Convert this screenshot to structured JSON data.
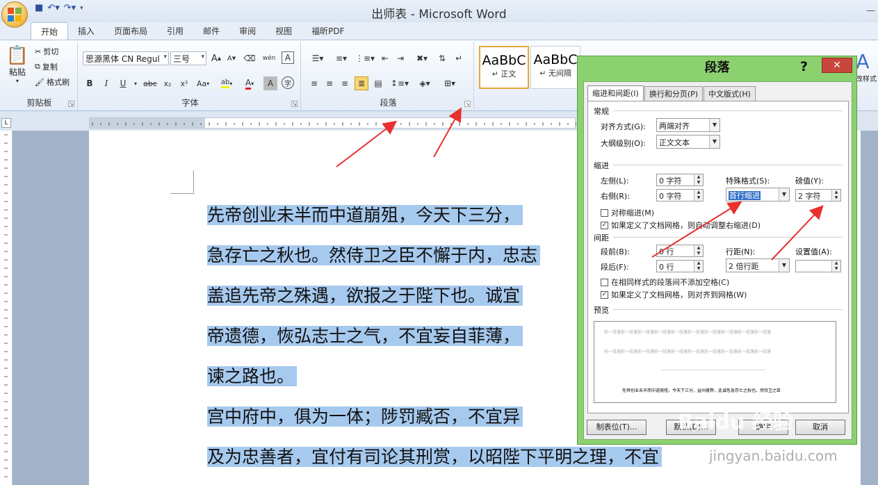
{
  "window": {
    "title": "出师表 - Microsoft Word",
    "colors": {
      "ribbon_bg": "#e4ecf7",
      "selection": "#a6c9ee",
      "dialog_frame": "#8cd16f",
      "close_red": "#c9463d",
      "arrow_red": "#e8302d"
    }
  },
  "ribbon": {
    "tabs": [
      "开始",
      "插入",
      "页面布局",
      "引用",
      "邮件",
      "审阅",
      "视图",
      "福昕PDF"
    ],
    "clipboard": {
      "paste": "粘贴",
      "cut": "剪切",
      "copy": "复制",
      "format_painter": "格式刷",
      "label": "剪贴板"
    },
    "font": {
      "name": "思源黑体 CN Regul",
      "size": "三号",
      "label": "字体",
      "bold": "B",
      "italic": "I",
      "underline": "U",
      "strike": "abc",
      "sub": "x₂",
      "sup": "x²",
      "case": "Aa",
      "grow": "A",
      "shrink": "A",
      "wen": "wén",
      "border_a": "A",
      "ab": "ab",
      "color_a": "A",
      "shade_a": "A"
    },
    "paragraph": {
      "label": "段落"
    },
    "styles": {
      "items": [
        {
          "sample": "AaBbC",
          "name": "↵ 正文"
        },
        {
          "sample": "AaBbC",
          "name": "↵ 无间隔"
        }
      ],
      "change_styles": "更改样式",
      "big_a": "A"
    }
  },
  "document": {
    "lines": [
      "先帝创业未半而中道崩殂，今天下三分，",
      "急存亡之秋也。然侍卫之臣不懈于内，忠志",
      "盖追先帝之殊遇，欲报之于陛下也。诚宜",
      "帝遗德，恢弘志士之气，不宜妄自菲薄，",
      "谏之路也。",
      "宫中府中，俱为一体；陟罚臧否，不宜异",
      "及为忠善者，宜付有司论其刑赏，以昭陛下平明之理，不宜"
    ]
  },
  "dialog": {
    "title": "段落",
    "help": "?",
    "close": "✕",
    "tabs": [
      "缩进和间距(I)",
      "换行和分页(P)",
      "中文版式(H)"
    ],
    "general": {
      "section": "常规",
      "align_label": "对齐方式(G):",
      "align_value": "两端对齐",
      "outline_label": "大纲级别(O):",
      "outline_value": "正文文本"
    },
    "indent": {
      "section": "缩进",
      "left_label": "左侧(L):",
      "left_value": "0 字符",
      "right_label": "右侧(R):",
      "right_value": "0 字符",
      "special_label": "特殊格式(S):",
      "special_value": "首行缩进",
      "by_label": "磅值(Y):",
      "by_value": "2 字符",
      "mirror": "对称缩进(M)",
      "auto_right": "如果定义了文档网格，则自动调整右缩进(D)"
    },
    "spacing": {
      "section": "间距",
      "before_label": "段前(B):",
      "before_value": "0 行",
      "after_label": "段后(F):",
      "after_value": "0 行",
      "line_label": "行距(N):",
      "line_value": "2 倍行距",
      "at_label": "设置值(A):",
      "at_value": "",
      "no_space": "在相同样式的段落间不添加空格(C)",
      "snap_grid": "如果定义了文档网格，则对齐到网格(W)"
    },
    "preview": {
      "section": "预览",
      "prev_text": "前一段落前一段落前一段落前一段落前一段落前一段落前一段落前一段落前一段落前一段落",
      "sample_text": "先帝创业未半而中道崩殂，今天下三分，益州疲弊，此诚危急存亡之秋也。然侍卫之臣"
    },
    "buttons": {
      "tabs": "制表位(T)...",
      "default": "默认(D)...",
      "ok": "确定",
      "cancel": "取消"
    }
  },
  "watermark": {
    "brand": "Baidu 经验",
    "url": "jingyan.baidu.com"
  }
}
